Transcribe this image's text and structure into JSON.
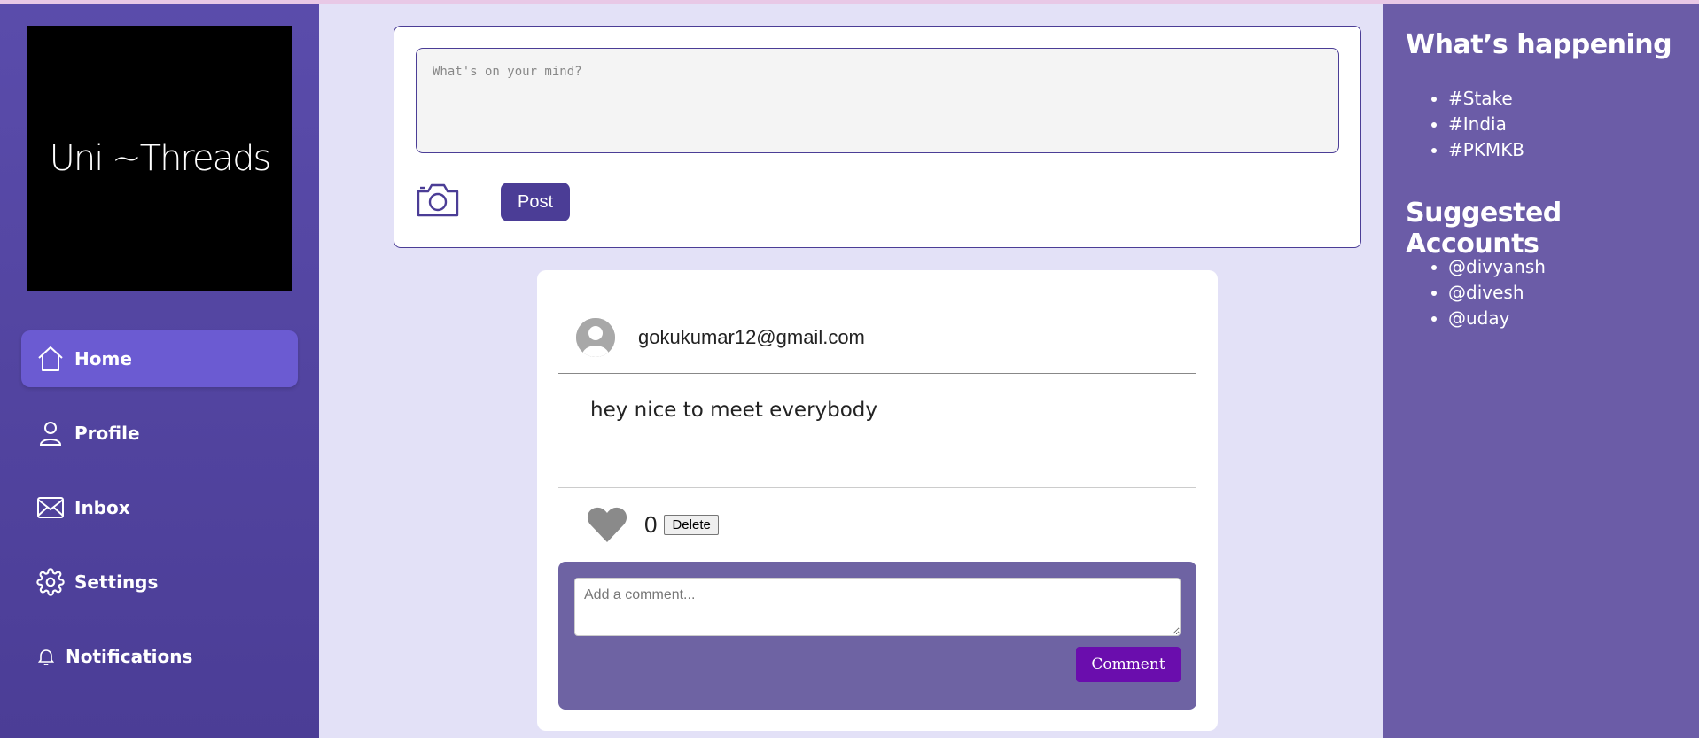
{
  "logo": {
    "text": "Uni ~Threads"
  },
  "nav": {
    "home": "Home",
    "profile": "Profile",
    "inbox": "Inbox",
    "settings": "Settings",
    "notifications": "Notifications"
  },
  "composer": {
    "placeholder": "What's on your mind?",
    "value": "",
    "post_label": "Post",
    "camera_icon": "camera-icon"
  },
  "post": {
    "author": "gokukumar12@gmail.com",
    "text": "hey nice to meet everybody",
    "likes": "0",
    "delete_label": "Delete",
    "comment_placeholder": "Add a comment...",
    "comment_label": "Comment"
  },
  "trending": {
    "title": "What’s happening",
    "items": [
      "#Stake",
      "#India",
      "#PKMKB"
    ]
  },
  "suggested": {
    "title": "Suggested Accounts",
    "items": [
      "@divyansh",
      "@divesh",
      "@uday"
    ]
  },
  "colors": {
    "primary": "#4b3d96",
    "active_nav": "#6b5bd2",
    "comment_button": "#6a0dad",
    "background": "#e3e1f7"
  }
}
